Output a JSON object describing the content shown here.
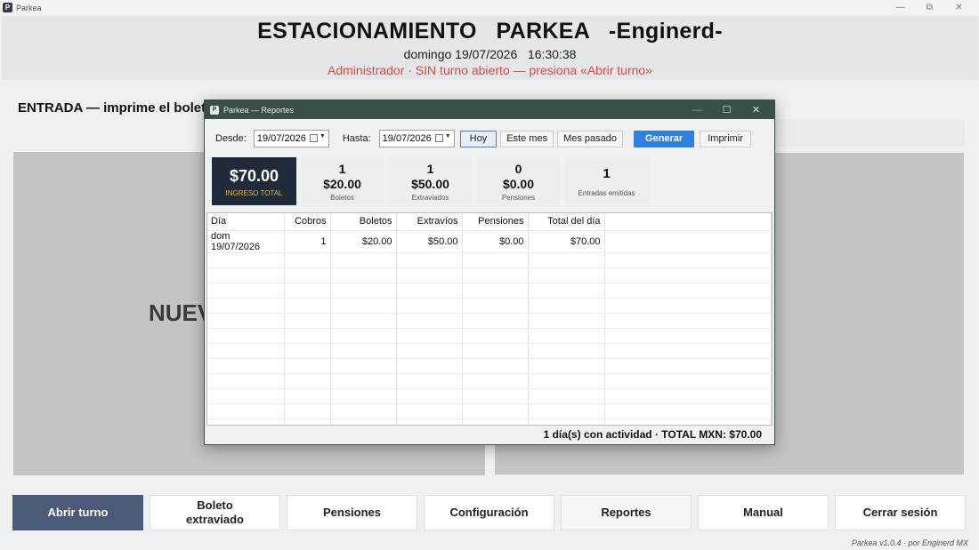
{
  "window": {
    "title": "Parkea",
    "icon_letter": "P",
    "controls": {
      "minimize": "—",
      "restore": "⧉",
      "close": "✕"
    }
  },
  "header": {
    "title": "ESTACIONAMIENTO   PARKEA   -Enginerd-",
    "date": "domingo 19/07/2026   16:30:38",
    "status": "Administrador  ·  SIN turno abierto — presiona «Abrir turno»"
  },
  "main": {
    "entrada_label": "ENTRADA — imprime el boleto",
    "panel_text": "NUEV"
  },
  "bottom_buttons": [
    {
      "label": "Abrir turno"
    },
    {
      "label": "Boleto\nextraviado"
    },
    {
      "label": "Pensiones"
    },
    {
      "label": "Configuración"
    },
    {
      "label": "Reportes"
    },
    {
      "label": "Manual"
    },
    {
      "label": "Cerrar sesión"
    }
  ],
  "footer": {
    "version": "Parkea v1.0.4 · por Enginerd MX"
  },
  "dialog": {
    "title": "Parkea — Reportes",
    "icon_letter": "P",
    "controls": {
      "minimize": "—",
      "maximize": "☐",
      "close": "✕"
    },
    "filters": {
      "desde_label": "Desde:",
      "desde_value": "19/07/2026",
      "hasta_label": "Hasta:",
      "hasta_value": "19/07/2026",
      "hoy": "Hoy",
      "este_mes": "Este mes",
      "mes_pasado": "Mes pasado",
      "generar": "Generar",
      "imprimir": "Imprimir"
    },
    "stats": {
      "total": {
        "amount": "$70.00",
        "label": "INGRESO TOTAL"
      },
      "boletos": {
        "count": "1",
        "amount": "$20.00",
        "label": "Boletos"
      },
      "extraviados": {
        "count": "1",
        "amount": "$50.00",
        "label": "Extraviados"
      },
      "pensiones": {
        "count": "0",
        "amount": "$0.00",
        "label": "Pensiones"
      },
      "entradas": {
        "amount": "1",
        "label": "Entradas emitidas"
      }
    },
    "table": {
      "headers": [
        "Día",
        "Cobros",
        "Boletos",
        "Extravíos",
        "Pensiones",
        "Total del día"
      ],
      "rows": [
        [
          "dom 19/07/2026",
          "1",
          "$20.00",
          "$50.00",
          "$0.00",
          "$70.00"
        ]
      ]
    },
    "footer_summary": "1 día(s) con actividad · TOTAL MXN: $70.00"
  }
}
